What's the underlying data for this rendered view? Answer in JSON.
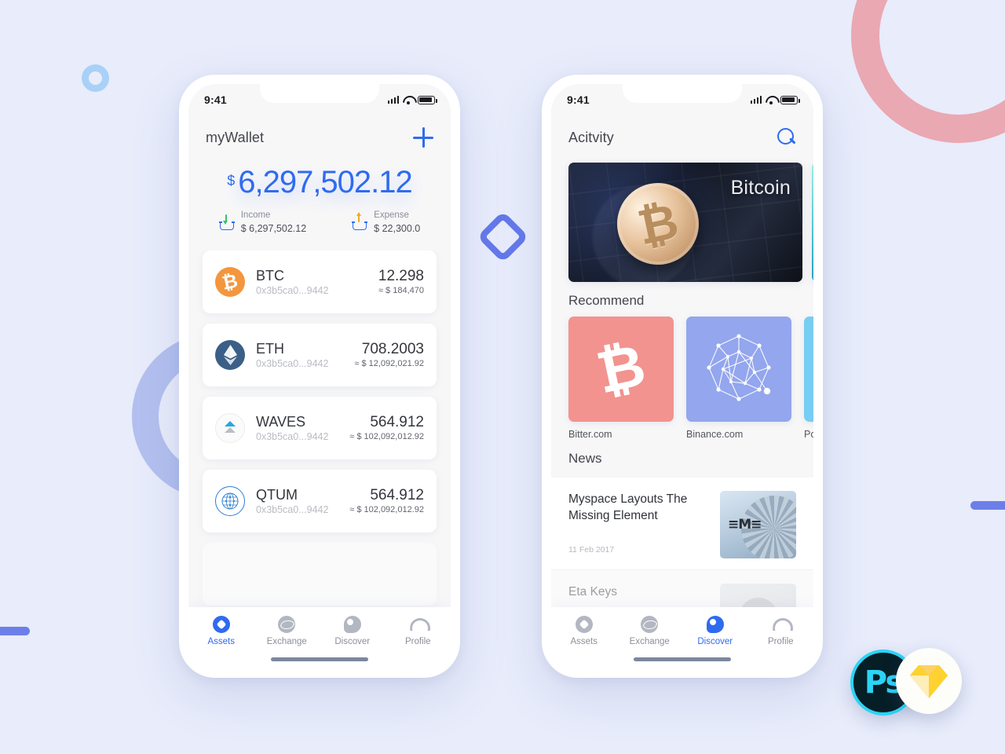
{
  "wallet_screen": {
    "statusbar": {
      "time": "9:41",
      "signal_icon": "signal-bars-icon",
      "wifi_icon": "wifi-icon",
      "battery_icon": "battery-icon"
    },
    "appbar": {
      "title": "myWallet",
      "add_icon": "plus-icon"
    },
    "balance": {
      "currency_symbol": "$",
      "amount": "6,297,502.12",
      "income": {
        "label": "Income",
        "value": "$ 6,297,502.12",
        "icon": "income-download-icon"
      },
      "expense": {
        "label": "Expense",
        "value": "$ 22,300.0",
        "icon": "expense-upload-icon"
      }
    },
    "assets": [
      {
        "symbol": "BTC",
        "address": "0x3b5ca0...9442",
        "amount": "12.298",
        "fiat": "≈ $ 184,470",
        "icon": "btc-coin-icon"
      },
      {
        "symbol": "ETH",
        "address": "0x3b5ca0...9442",
        "amount": "708.2003",
        "fiat": "≈ $ 12,092,021.92",
        "icon": "eth-coin-icon"
      },
      {
        "symbol": "WAVES",
        "address": "0x3b5ca0...9442",
        "amount": "564.912",
        "fiat": "≈ $ 102,092,012.92",
        "icon": "waves-coin-icon"
      },
      {
        "symbol": "QTUM",
        "address": "0x3b5ca0...9442",
        "amount": "564.912",
        "fiat": "≈ $ 102,092,012.92",
        "icon": "qtum-coin-icon"
      }
    ],
    "tabs": [
      {
        "label": "Assets",
        "icon": "assets-icon",
        "active": true
      },
      {
        "label": "Exchange",
        "icon": "exchange-icon",
        "active": false
      },
      {
        "label": "Discover",
        "icon": "discover-icon",
        "active": false
      },
      {
        "label": "Profile",
        "icon": "profile-icon",
        "active": false
      }
    ]
  },
  "discover_screen": {
    "statusbar": {
      "time": "9:41",
      "signal_icon": "signal-bars-icon",
      "wifi_icon": "wifi-icon",
      "battery_icon": "battery-icon"
    },
    "appbar": {
      "title": "Acitvity",
      "search_icon": "search-icon"
    },
    "banners": [
      {
        "label": "Bitcoin",
        "image": "bitcoin-coin-on-keyboard-photo"
      },
      {
        "label": "",
        "image": "teal-abstract-photo"
      }
    ],
    "recommend": {
      "title": "Recommend",
      "items": [
        {
          "name": "Bitter.com",
          "tile_color": "#f2938f",
          "icon": "bitcoin-b-icon"
        },
        {
          "name": "Binance.com",
          "tile_color": "#93a6ee",
          "icon": "binance-network-icon"
        },
        {
          "name": "Polone",
          "tile_color": "#78cdf3",
          "icon": "poloniex-icon"
        }
      ]
    },
    "news": {
      "title": "News",
      "items": [
        {
          "title": "Myspace Layouts The Missing Element",
          "date": "11 Feb 2017",
          "thumb": "ibm-server-photo"
        },
        {
          "title": "Eta Keys",
          "date": "",
          "thumb": "avatar-photo"
        }
      ]
    },
    "tabs": [
      {
        "label": "Assets",
        "icon": "assets-icon",
        "active": false
      },
      {
        "label": "Exchange",
        "icon": "exchange-icon",
        "active": false
      },
      {
        "label": "Discover",
        "icon": "discover-icon",
        "active": true
      },
      {
        "label": "Profile",
        "icon": "profile-icon",
        "active": false
      }
    ]
  },
  "decorations": {
    "ring_pink": "#eaa8b2",
    "ring_purple": "#b3c0ef",
    "ring_small_blue": "#a9d1f7",
    "diamond": "#6479ea",
    "bar": "#6c7fe8",
    "background": "#e8ecfb",
    "accent": "#2f6bf0"
  },
  "badges": {
    "photoshop": {
      "label": "Ps",
      "icon": "photoshop-icon"
    },
    "sketch": {
      "label": "",
      "icon": "sketch-gem-icon"
    }
  }
}
